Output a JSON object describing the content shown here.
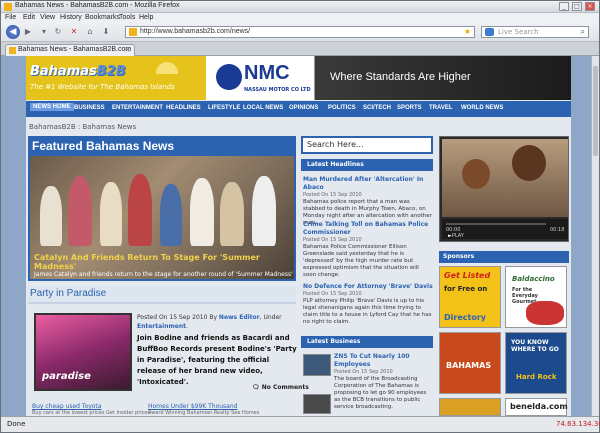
{
  "window": {
    "title": "Bahamas News - BahamasB2B.com - Mozilla Firefox"
  },
  "menu": [
    "File",
    "Edit",
    "View",
    "History",
    "Bookmarks",
    "Tools",
    "Help"
  ],
  "toolbar": {
    "url": "http://www.bahamasb2b.com/news/",
    "search_placeholder": "Live Search"
  },
  "tab": {
    "label": "Bahamas News - BahamasB2B.com"
  },
  "status": {
    "left": "Done",
    "ip": "74.63.134.36"
  },
  "site": {
    "logo_word": "Bahamas",
    "logo_b2b": "B2B",
    "logo_tagline": "The #1 Website for The Bahamas Islands",
    "ad_brand": "NMC",
    "ad_brand_sub": "NASSAU MOTOR CO LTD",
    "ad_slogan": "Where Standards Are Higher",
    "nav": [
      "NEWS HOME",
      "BUSINESS",
      "ENTERTAINMENT",
      "HEADLINES",
      "LIFESTYLE",
      "LOCAL NEWS",
      "OPINIONS",
      "POLITICS",
      "SCI/TECH",
      "SPORTS",
      "TRAVEL",
      "WORLD NEWS"
    ],
    "breadcrumb": "BahamasB2B : Bahamas News"
  },
  "featured": {
    "title": "Featured Bahamas News",
    "caption": "Catalyn And Friends Return To Stage For 'Summer Madness'",
    "subcaption": "James Catalyn and friends return to the stage for another round of 'Summer Madness'"
  },
  "party": {
    "title": "Party in Paradise",
    "posted": "Posted On 15 Sep 2010 By",
    "author": "News Editor",
    "under": "Under",
    "category": "Entertainment",
    "blurb": "Join Bodine and friends as Bacardi and BuffBoo Records present Bodine's 'Party in Paradise', featuring the official release of her brand new video, 'Intoxicated'.",
    "comments": "No Comments",
    "image_word": "paradise"
  },
  "minilinks": [
    {
      "title": "Buy cheap used Toyota",
      "sub": "Buy cars at the lowest prices Get Insider prices"
    },
    {
      "title": "Homes Under $99K Thousand",
      "sub": "Award Winning Bahamian Realty See Homes"
    }
  ],
  "search": {
    "placeholder": "Search Here..."
  },
  "latest_headlines": {
    "title": "Latest Headlines",
    "items": [
      {
        "title": "Man Murdered After 'Altercation' In Abaco",
        "date": "Posted On 15 Sep 2010",
        "text": "Bahamas police report that a man was stabbed to death in Murphy Town, Abaco, on Monday night after an altercation with another man."
      },
      {
        "title": "Crime Talking Toll on Bahamas Police Commissioner",
        "date": "Posted On 15 Sep 2010",
        "text": "Bahamas Police Commissioner Ellison Greenslade said yesterday that he is 'depressed' by the high murder rate but expressed optimism that the situation will soon change."
      },
      {
        "title": "No Defence For Attorney 'Brave' Davis",
        "date": "Posted On 15 Sep 2010",
        "text": "PLP attorney Philip 'Brave' Davis is up to his legal shenanigans again this time trying to claim title to a house in Lyford Cay that he has no right to claim."
      }
    ]
  },
  "latest_business": {
    "title": "Latest Business",
    "items": [
      {
        "title": "ZNS To Cut Nearly 100 Employees",
        "date": "Posted On 15 Sep 2010",
        "text": "The board of the Broadcasting Corporation of The Bahamas is proposing to let go 90 employees as the BCB transitions to public service broadcasting."
      }
    ]
  },
  "video": {
    "time_start": "00:00",
    "time_end": "00:18",
    "play_label": "PLAY"
  },
  "sponsors": {
    "title": "Sponsors",
    "ads": [
      {
        "line1": "Get Listed",
        "line2": "for Free on",
        "line3": "Directory",
        "color": "#f2c218"
      },
      {
        "line1": "Baldaccino",
        "line2": "For the Everyday Gourmet",
        "line3": "",
        "color": "#2e6b2e"
      },
      {
        "line1": "BAHAMAS",
        "line2": "",
        "line3": "",
        "color": "#c84a1c"
      },
      {
        "line1": "YOU KNOW WHERE TO GO",
        "line2": "Hard Rock",
        "line3": "",
        "color": "#1c4a8c"
      },
      {
        "line1": "",
        "line2": "",
        "line3": "",
        "color": "#d9a024"
      },
      {
        "line1": "benelda.com",
        "line2": "",
        "line3": "",
        "color": "#ffffff"
      }
    ]
  },
  "colors": {
    "brand_blue": "#2c63b0",
    "logo_yellow": "#e6c31a",
    "ad_dark": "#1b1b1b"
  }
}
